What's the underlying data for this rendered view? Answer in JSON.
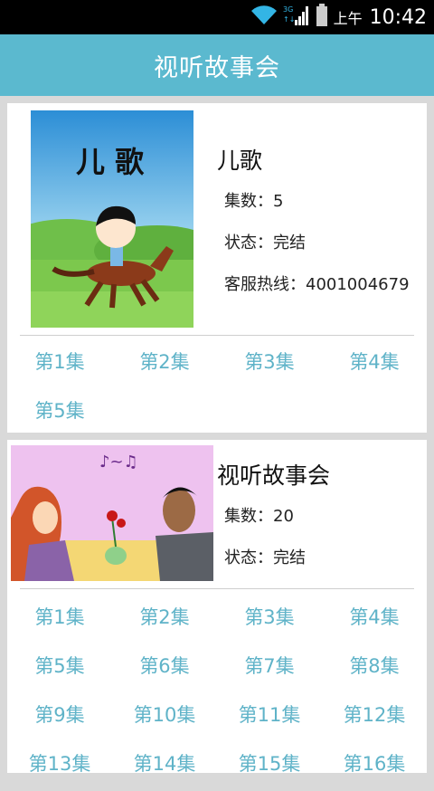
{
  "status_bar": {
    "network": "3G",
    "ampm": "上午",
    "time": "10:42"
  },
  "app_bar": {
    "title": "视听故事会"
  },
  "cards": [
    {
      "image_caption": "儿 歌",
      "name": "儿歌",
      "episode_count": "集数：5",
      "status": "状态：完结",
      "hotline": "客服热线：4001004679",
      "episodes": [
        "第1集",
        "第2集",
        "第3集",
        "第4集",
        "第5集"
      ]
    },
    {
      "name": "视听故事会",
      "episode_count": "集数：20",
      "status": "状态：完结",
      "episodes": [
        "第1集",
        "第2集",
        "第3集",
        "第4集",
        "第5集",
        "第6集",
        "第7集",
        "第8集",
        "第9集",
        "第10集",
        "第11集",
        "第12集",
        "第13集",
        "第14集",
        "第15集",
        "第16集"
      ]
    }
  ],
  "colors": {
    "app_bar": "#5bb9cf",
    "episode_link": "#5fb3c8",
    "background": "#d9d9d9"
  }
}
